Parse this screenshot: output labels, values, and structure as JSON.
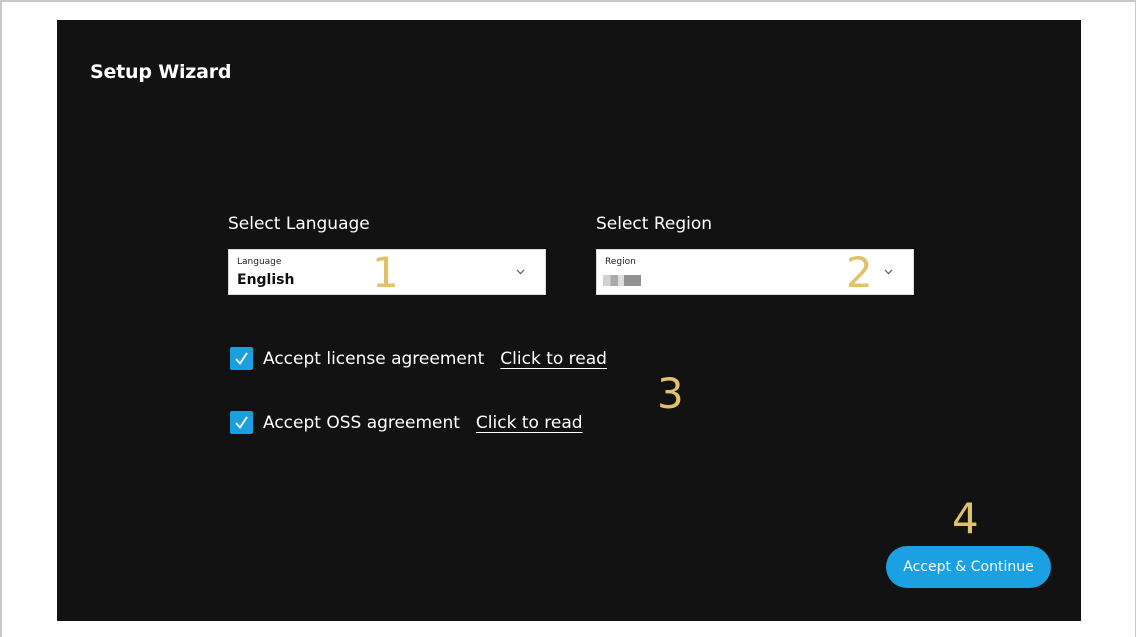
{
  "wizard": {
    "title": "Setup Wizard"
  },
  "language": {
    "section_label": "Select Language",
    "field_caption": "Language",
    "value": "English"
  },
  "region": {
    "section_label": "Select Region",
    "field_caption": "Region",
    "value": "(redacted)"
  },
  "agreements": [
    {
      "label": "Accept license agreement",
      "link": "Click to read",
      "checked": true
    },
    {
      "label": "Accept OSS agreement",
      "link": "Click to read",
      "checked": true
    }
  ],
  "actions": {
    "accept_label": "Accept & Continue"
  },
  "annotations": [
    "1",
    "2",
    "3",
    "4"
  ],
  "colors": {
    "background": "#121212",
    "accent": "#1ba0e1",
    "annotation": "#e0c26a"
  }
}
